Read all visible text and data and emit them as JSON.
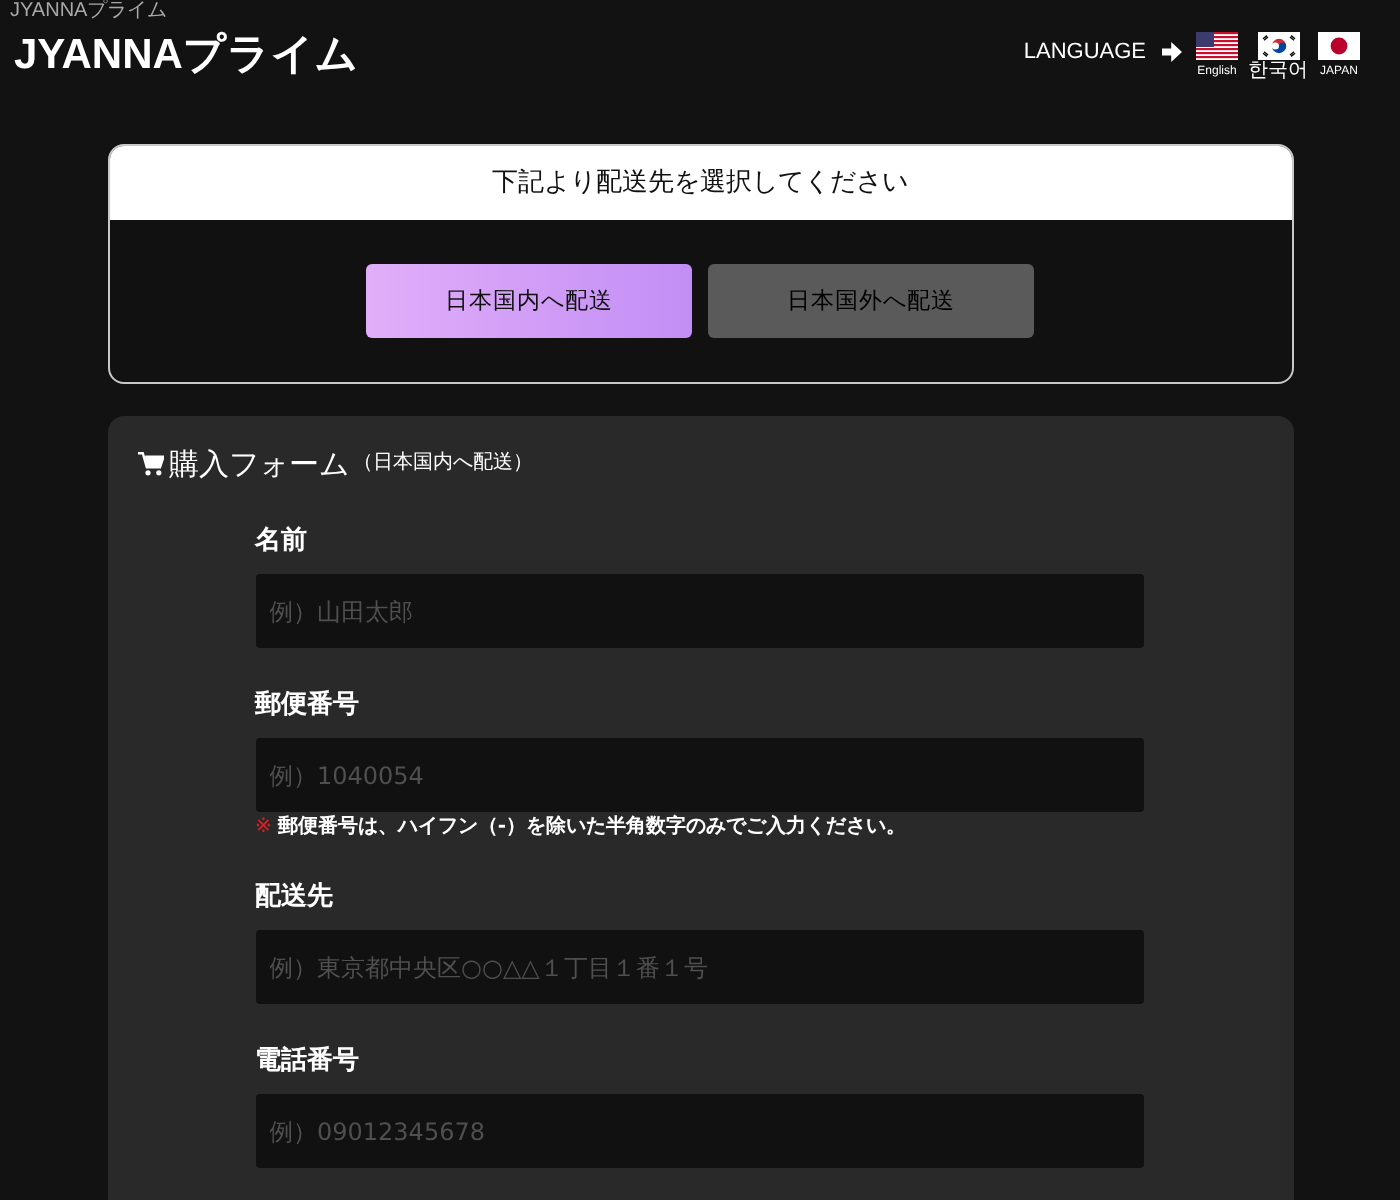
{
  "header": {
    "site_name": "JYANNAプライム",
    "logo": "JYANNAプライム",
    "language_label": "LANGUAGE",
    "languages": [
      {
        "kind": "us",
        "label": "English"
      },
      {
        "kind": "kr",
        "label": "한국어"
      },
      {
        "kind": "jp",
        "label": "JAPAN"
      }
    ]
  },
  "destination": {
    "title": "下記より配送先を選択してください",
    "options": [
      {
        "label": "日本国内へ配送",
        "selected": true
      },
      {
        "label": "日本国外へ配送",
        "selected": false
      }
    ]
  },
  "form": {
    "title": "購入フォーム",
    "subtitle": "（日本国内へ配送）",
    "fields": [
      {
        "label": "名前",
        "placeholder": "例）山田太郎"
      },
      {
        "label": "郵便番号",
        "placeholder": "例）1040054",
        "note": {
          "mark": "※",
          "text": "郵便番号は、ハイフン（-）を除いた半角数字のみでご入力ください。"
        }
      },
      {
        "label": "配送先",
        "placeholder": "例）東京都中央区○○△△１丁目１番１号"
      },
      {
        "label": "電話番号",
        "placeholder": "例）09012345678"
      }
    ]
  }
}
